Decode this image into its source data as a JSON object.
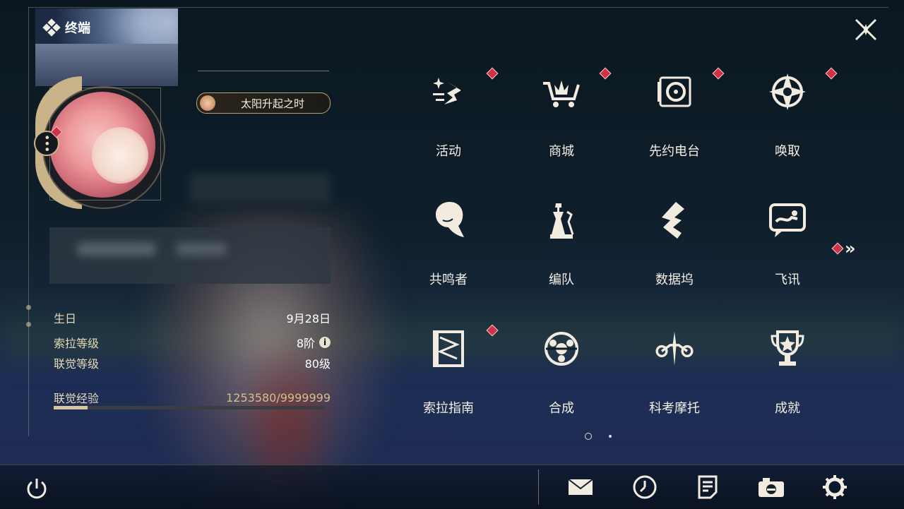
{
  "header": {
    "title": "终端",
    "title_icon": "terminal-diamond-icon"
  },
  "profile": {
    "title_badge": "太阳升起之时",
    "fields": [
      {
        "label": "生日",
        "value": "9月28日"
      },
      {
        "label": "索拉等级",
        "value": "8阶"
      },
      {
        "label": "联觉等级",
        "value": "80级"
      },
      {
        "label": "联觉经验",
        "value": "1253580/9999999"
      }
    ],
    "exp_progress": 0.1254
  },
  "menu": {
    "items": [
      {
        "label": "活动",
        "icon": "event-sparkle-icon",
        "badge": true
      },
      {
        "label": "商城",
        "icon": "shop-cart-icon",
        "badge": true
      },
      {
        "label": "先约电台",
        "icon": "radio-icon",
        "badge": true
      },
      {
        "label": "唤取",
        "icon": "convene-star-icon",
        "badge": true
      },
      {
        "label": "共鸣者",
        "icon": "resonator-icon",
        "badge": false
      },
      {
        "label": "编队",
        "icon": "team-chess-icon",
        "badge": false
      },
      {
        "label": "数据坞",
        "icon": "data-bank-icon",
        "badge": false
      },
      {
        "label": "飞讯",
        "icon": "messenger-icon",
        "badge": false
      },
      {
        "label": "索拉指南",
        "icon": "guidebook-icon",
        "badge": true
      },
      {
        "label": "合成",
        "icon": "synthesis-icon",
        "badge": false
      },
      {
        "label": "科考摩托",
        "icon": "motorbike-icon",
        "badge": false
      },
      {
        "label": "成就",
        "icon": "trophy-icon",
        "badge": false
      }
    ],
    "page_current": 1,
    "page_total": 2
  },
  "colors": {
    "accent_gold": "#c9b48a",
    "badge_red": "#d0324a",
    "text_light": "#f4f0e6"
  }
}
